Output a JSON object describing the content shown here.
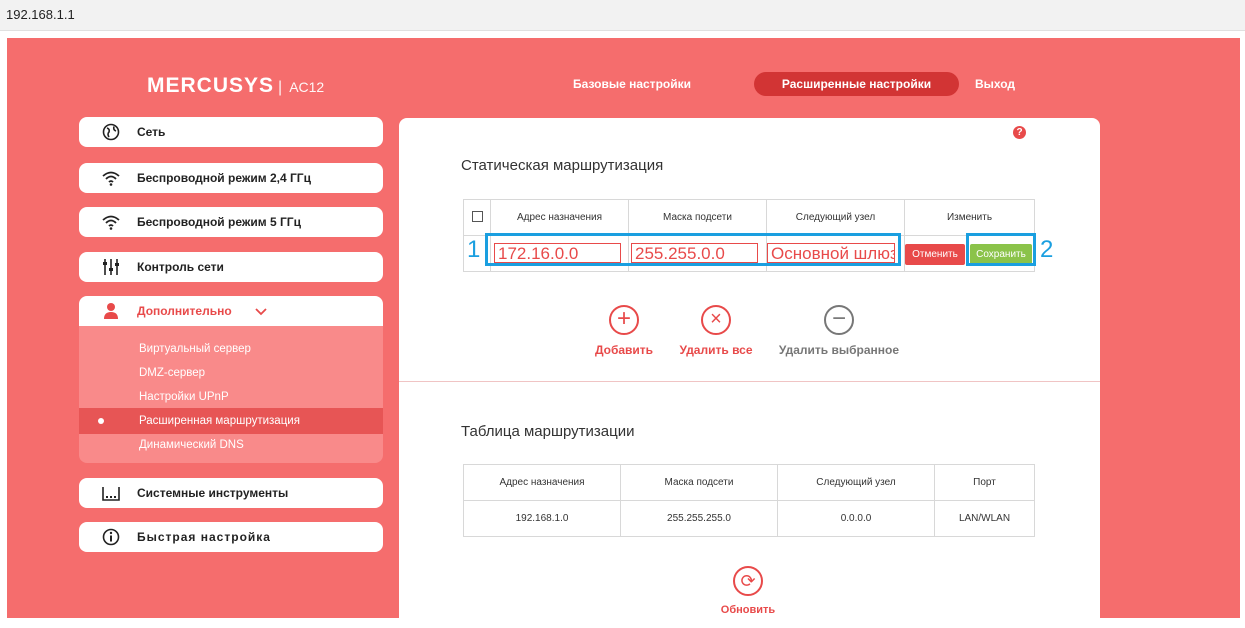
{
  "browser": {
    "address": "192.168.1.1"
  },
  "brand": {
    "logo": "MERCUSYS",
    "separator": "|",
    "model": "AC12"
  },
  "topnav": {
    "basic": "Базовые настройки",
    "advanced": "Расширенные настройки",
    "logout": "Выход"
  },
  "sidebar": {
    "items": [
      {
        "label": "Сеть",
        "icon": "globe-icon"
      },
      {
        "label": "Беспроводной режим 2,4 ГГц",
        "icon": "wifi-icon"
      },
      {
        "label": "Беспроводной режим 5 ГГц",
        "icon": "wifi-icon"
      },
      {
        "label": "Контроль сети",
        "icon": "sliders-icon"
      },
      {
        "label": "Дополнительно",
        "icon": "user-icon"
      },
      {
        "label": "Системные инструменты",
        "icon": "tools-icon"
      },
      {
        "label": "Быстрая настройка",
        "icon": "info-icon"
      }
    ],
    "submenu": [
      "Виртуальный сервер",
      "DMZ-сервер",
      "Настройки UPnP",
      "Расширенная маршрутизация",
      "Динамический DNS"
    ]
  },
  "static_routing": {
    "title": "Статическая маршрутизация",
    "headers": [
      "Адрес назначения",
      "Маска подсети",
      "Следующий узел",
      "Изменить"
    ],
    "edit": {
      "destination": "172.16.0.0",
      "mask": "255.255.0.0",
      "gateway": "Основной шлюз"
    },
    "cancel_label": "Отменить",
    "save_label": "Сохранить",
    "annotations": [
      "1",
      "2"
    ],
    "actions": {
      "add": "Добавить",
      "delete_all": "Удалить все",
      "delete_selected": "Удалить выбранное"
    }
  },
  "routing_table": {
    "title": "Таблица маршрутизации",
    "headers": [
      "Адрес назначения",
      "Маска подсети",
      "Следующий узел",
      "Порт"
    ],
    "rows": [
      [
        "192.168.1.0",
        "255.255.255.0",
        "0.0.0.0",
        "LAN/WLAN"
      ]
    ],
    "refresh_label": "Обновить"
  },
  "colors": {
    "brand_red": "#f56d6d",
    "accent_red": "#e84a4a",
    "active_nav": "#d23434",
    "save_green": "#8bc34a",
    "highlight_blue": "#1a9fe0"
  }
}
